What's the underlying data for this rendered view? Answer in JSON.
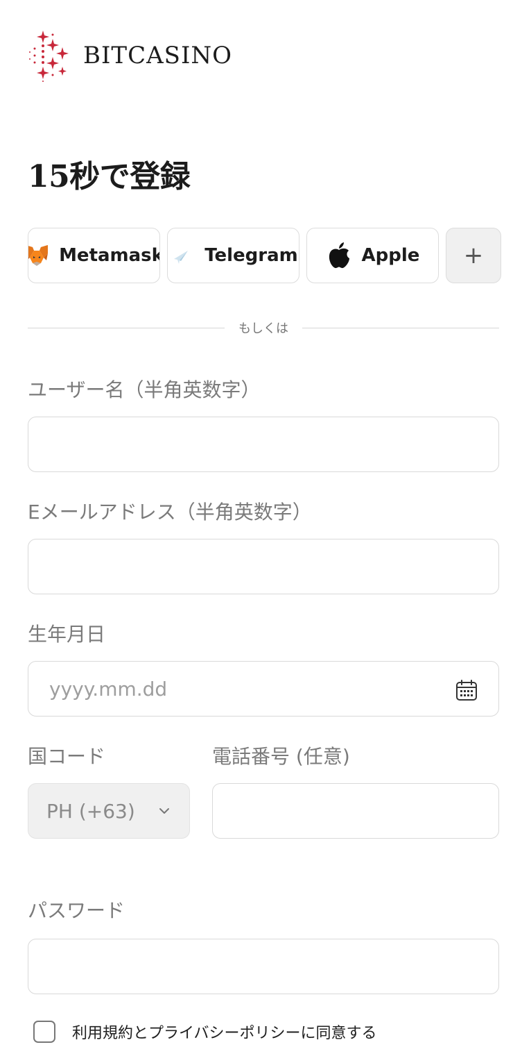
{
  "brand": {
    "name": "BITCASINO",
    "accent": "#c8283a"
  },
  "page": {
    "title": "15秒で登録"
  },
  "social": {
    "metamask": "Metamask",
    "telegram": "Telegram",
    "apple": "Apple",
    "more": "+"
  },
  "divider": {
    "text": "もしくは"
  },
  "form": {
    "username_label": "ユーザー名（半角英数字）",
    "username_value": "",
    "email_label": "Eメールアドレス（半角英数字）",
    "email_value": "",
    "birthdate_label": "生年月日",
    "birthdate_placeholder": "yyyy.mm.dd",
    "country_code_label": "国コード",
    "country_code_value": "PH (+63)",
    "phone_label": "電話番号 (任意)",
    "phone_value": "",
    "password_label": "パスワード",
    "password_value": "",
    "agree_text": "利用規約とプライバシーポリシーに同意する"
  }
}
